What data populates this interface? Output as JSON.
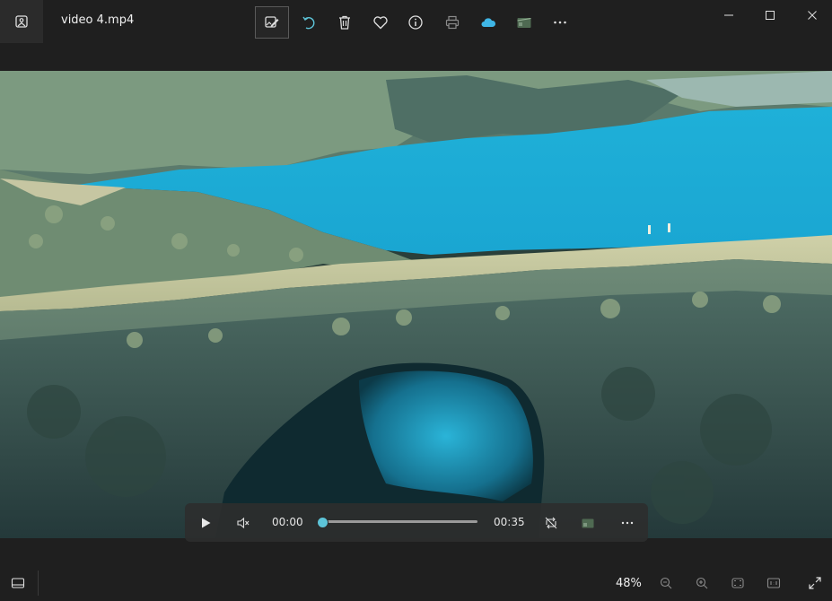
{
  "title_bar": {
    "file_name": "video 4.mp4",
    "toolbar_icons": [
      "edit-image-icon",
      "rotate-icon",
      "delete-icon",
      "favorite-icon",
      "info-icon",
      "print-icon",
      "onedrive-cloud-icon",
      "clipchamp-icon",
      "more-options-icon"
    ],
    "window_controls": [
      "minimize",
      "maximize",
      "close"
    ]
  },
  "player": {
    "current_time": "00:00",
    "duration": "00:35",
    "progress": 0.0,
    "muted": true
  },
  "status_bar": {
    "zoom_level": "48%"
  },
  "colors": {
    "background": "#1f1f1f",
    "accent": "#5dc4d8",
    "cloud": "#3fb6e6"
  }
}
